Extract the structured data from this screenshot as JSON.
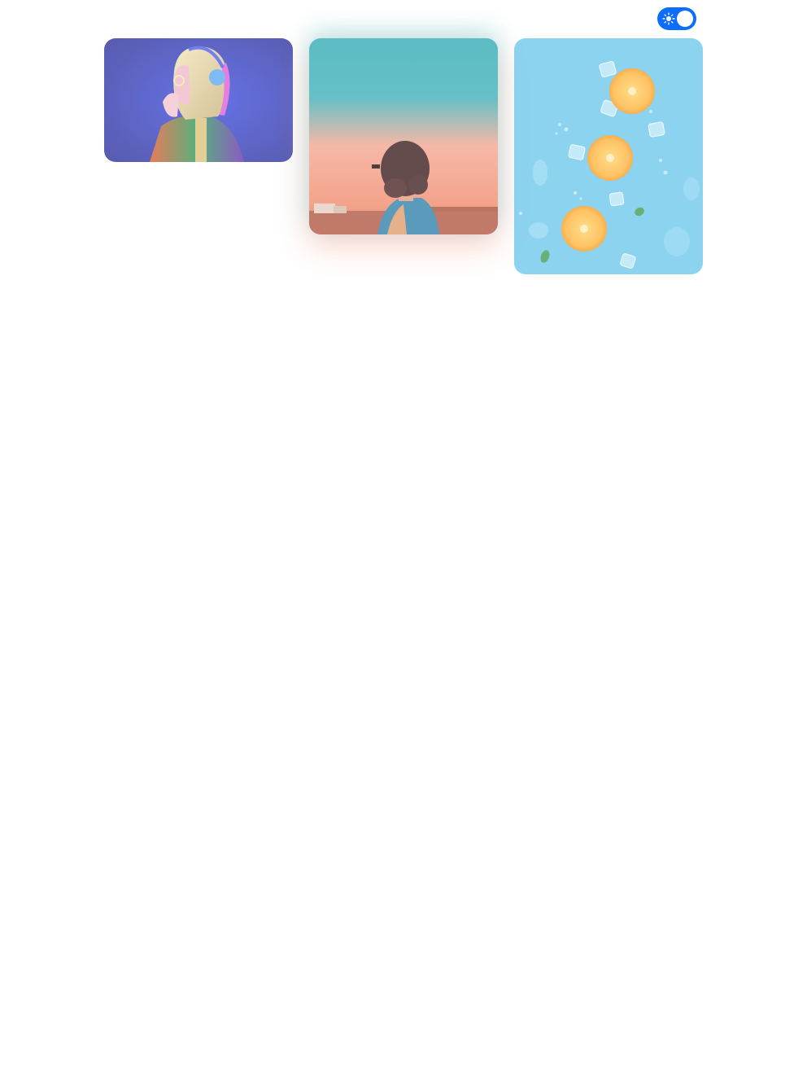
{
  "header": {
    "theme_toggle": {
      "state": "light",
      "on": true,
      "icon": "sun-icon",
      "color": "#0d6efd"
    }
  },
  "gallery": {
    "items": [
      {
        "subject": "woman-with-headphones-neon",
        "icon": "image"
      },
      {
        "subject": "woman-sunset-teal-sky",
        "icon": "image"
      },
      {
        "subject": "orange-slices-ice-cubes-blue",
        "icon": "image"
      }
    ]
  }
}
